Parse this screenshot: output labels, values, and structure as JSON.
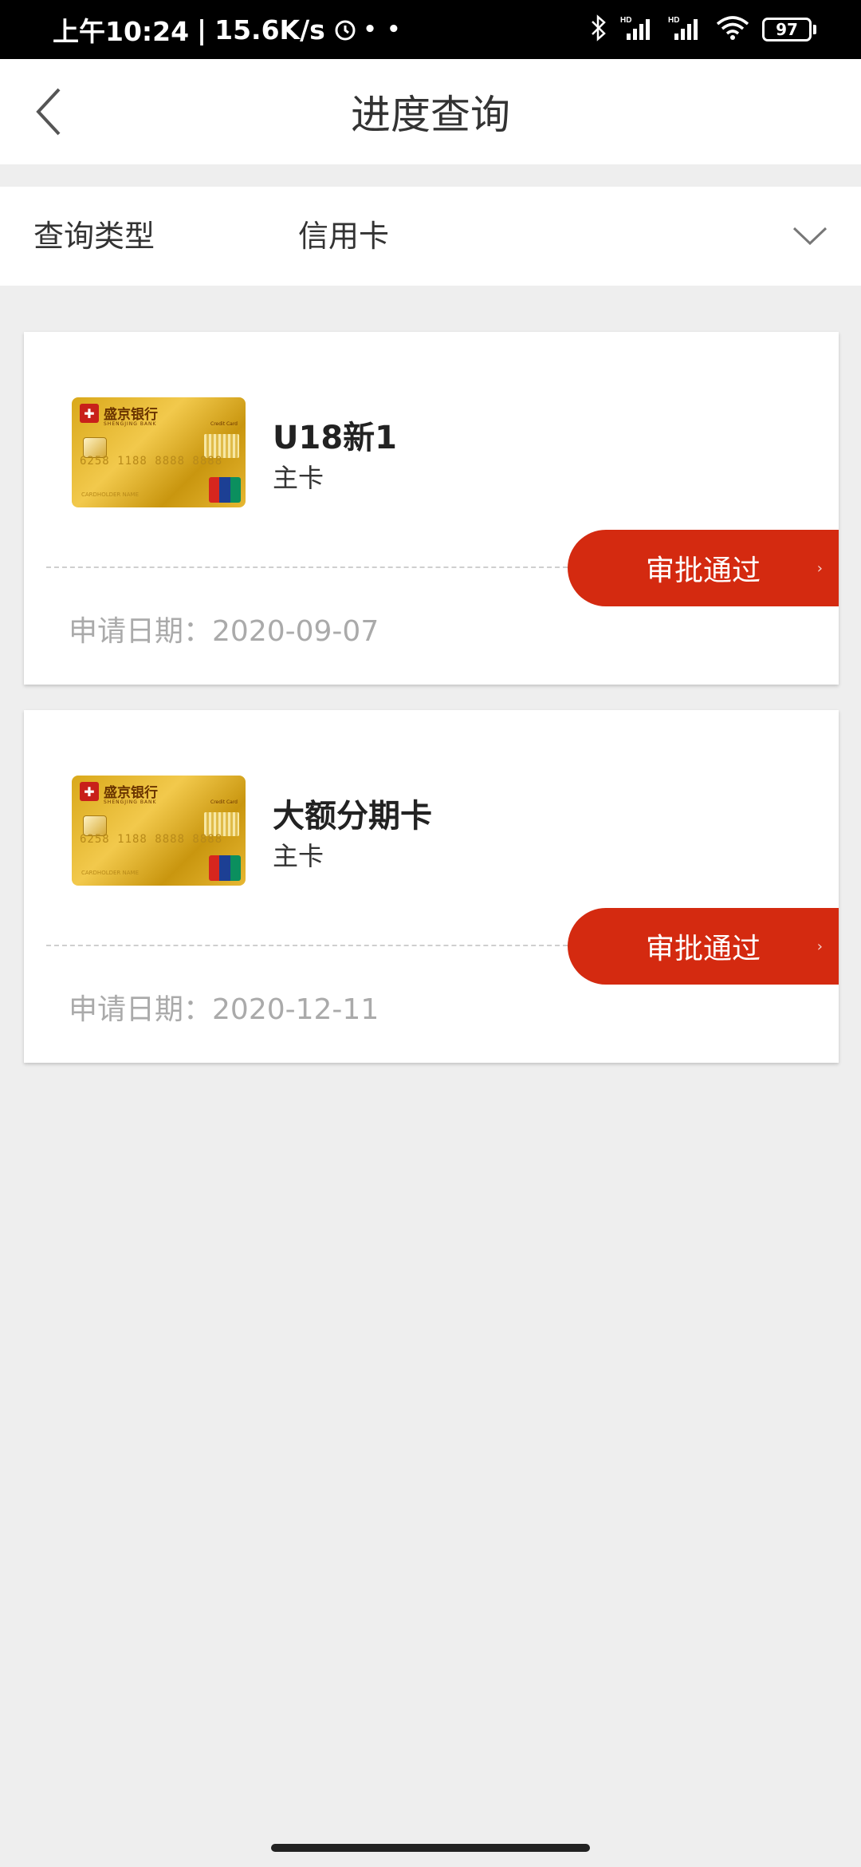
{
  "status_bar": {
    "time": "上午10:24",
    "speed": "15.6K/s",
    "battery": "97",
    "icons": [
      "alarm-icon",
      "bluetooth-icon",
      "signal-hd-icon",
      "signal-hd-icon",
      "wifi-icon",
      "battery-icon"
    ]
  },
  "header": {
    "title": "进度查询",
    "back_icon": "chevron-left-icon"
  },
  "query": {
    "label": "查询类型",
    "value": "信用卡",
    "dropdown_icon": "chevron-down-icon"
  },
  "card_image": {
    "bank_name": "盛京银行",
    "bank_name_en": "SHENGJING BANK",
    "badge": "Credit Card",
    "number": "6258 1188 8888 8888",
    "holder": "CARDHOLDER NAME"
  },
  "applications": [
    {
      "name": "U18新1",
      "type": "主卡",
      "status": "审批通过",
      "date_label": "申请日期：",
      "date": "2020-09-07"
    },
    {
      "name": "大额分期卡",
      "type": "主卡",
      "status": "审批通过",
      "date_label": "申请日期：",
      "date": "2020-12-11"
    }
  ],
  "colors": {
    "status_bg": "#d42a10",
    "page_bg": "#eeeeee"
  }
}
